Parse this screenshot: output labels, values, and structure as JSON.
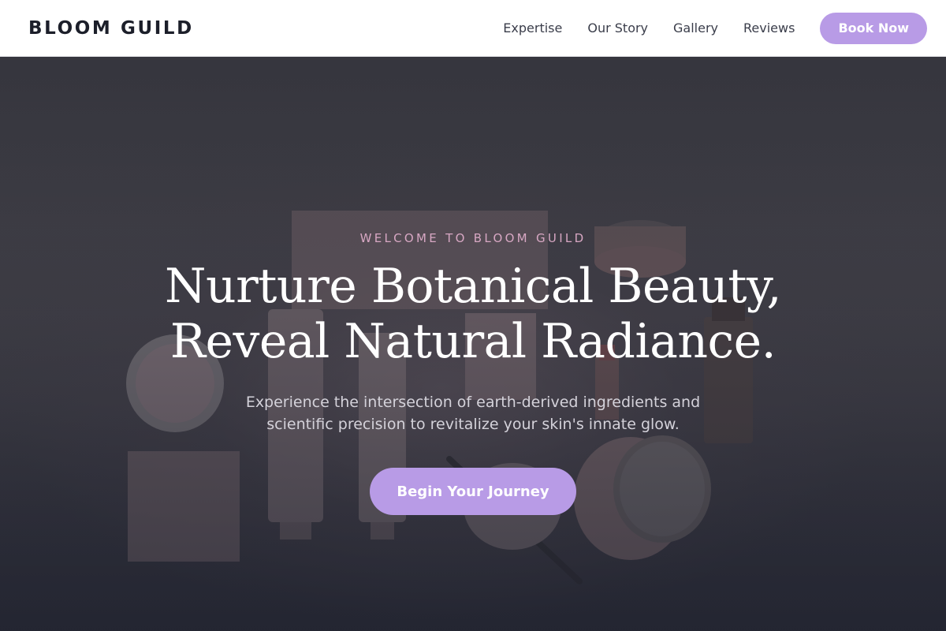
{
  "header": {
    "logo": "BLOOM GUILD",
    "nav": [
      {
        "label": "Expertise"
      },
      {
        "label": "Our Story"
      },
      {
        "label": "Gallery"
      },
      {
        "label": "Reviews"
      }
    ],
    "cta_label": "Book Now"
  },
  "hero": {
    "eyebrow": "WELCOME TO BLOOM GUILD",
    "headline_line1": "Nurture Botanical Beauty,",
    "headline_line2": "Reveal Natural Radiance.",
    "subtext": "Experience the intersection of earth-derived ingredients and scientific precision to revitalize your skin's innate glow.",
    "cta_label": "Begin Your Journey"
  },
  "colors": {
    "accent": "#b89be6",
    "eyebrow": "#d7a7c3",
    "logo": "#1c1f2a"
  }
}
